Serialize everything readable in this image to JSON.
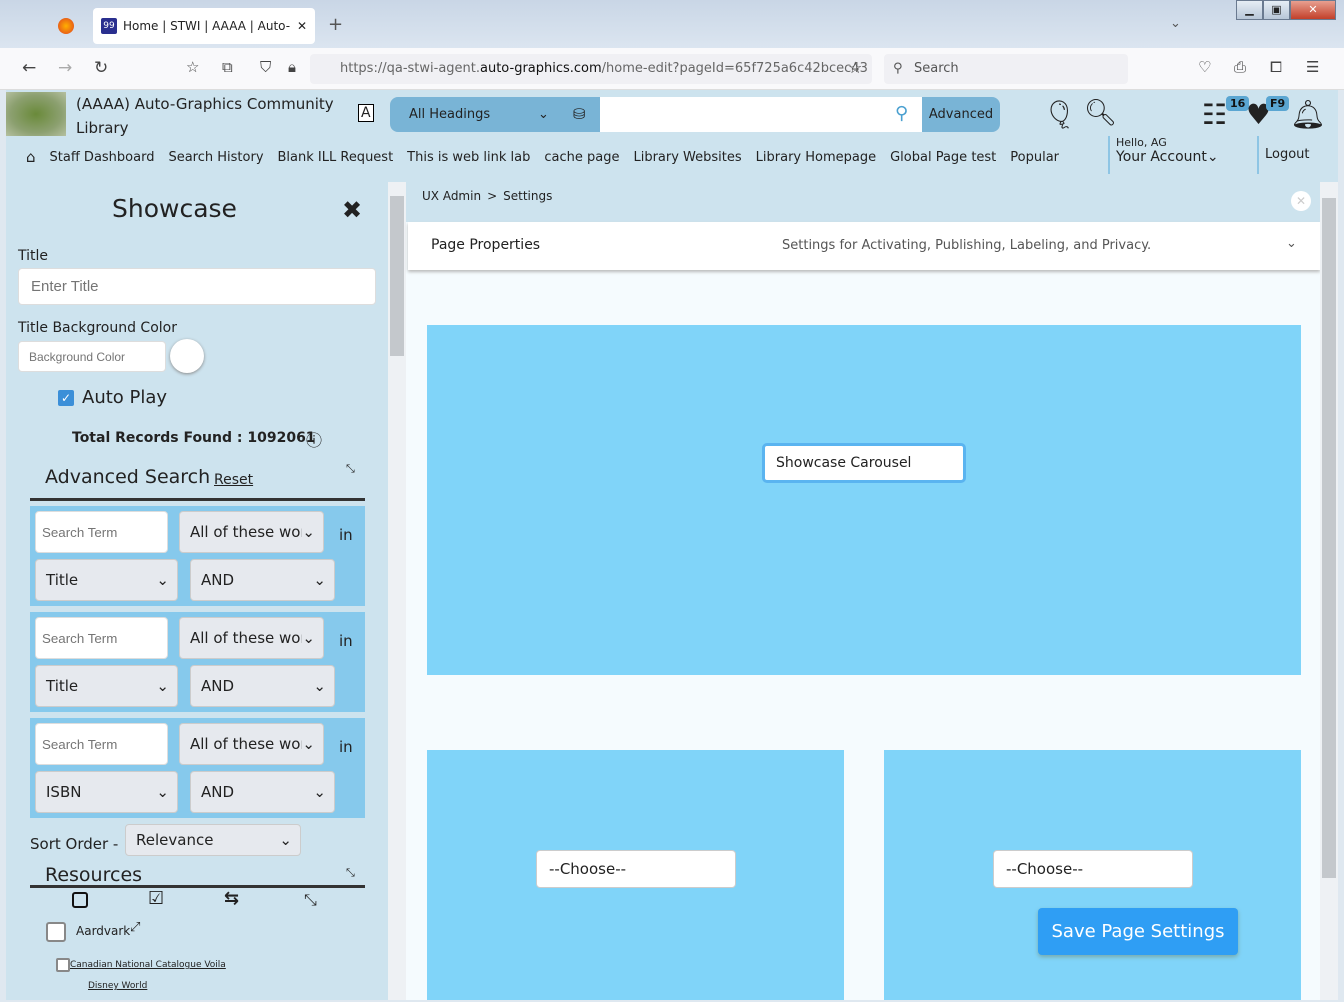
{
  "browser": {
    "tab_title": "Home | STWI | AAAA | Auto-Gra",
    "new_tab": "+",
    "url_prefix": "https://qa-stwi-agent.",
    "url_domain": "auto-graphics.com",
    "url_suffix": "/home-edit?pageId=65f725a6c42bcec43",
    "search_placeholder": "Search"
  },
  "header": {
    "library_name": "(AAAA) Auto-Graphics Community Library",
    "search_scope": "All Headings",
    "search_value": "",
    "advanced": "Advanced",
    "list_badge": "16",
    "fav_badge": "F9"
  },
  "nav": {
    "items": [
      "Staff Dashboard",
      "Search History",
      "Blank ILL Request",
      "This is web link lab",
      "cache page",
      "Library Websites",
      "Library Homepage",
      "Global Page test",
      "Popular"
    ],
    "greeting": "Hello, AG",
    "account": "Your Account",
    "logout": "Logout"
  },
  "panel": {
    "title": "Showcase",
    "title_label": "Title",
    "title_placeholder": "Enter Title",
    "bg_label": "Title Background Color",
    "bg_placeholder": "Background Color",
    "autoplay": "Auto Play",
    "autoplay_checked": true,
    "total": "Total Records Found : 1092061",
    "adv_search": "Advanced Search",
    "reset": "Reset",
    "rows": [
      {
        "term_placeholder": "Search Term",
        "match": "All of these words",
        "in": "in",
        "field": "Title",
        "op": "AND"
      },
      {
        "term_placeholder": "Search Term",
        "match": "All of these words",
        "in": "in",
        "field": "Title",
        "op": "AND"
      },
      {
        "term_placeholder": "Search Term",
        "match": "All of these words",
        "in": "in",
        "field": "ISBN",
        "op": "AND"
      }
    ],
    "sort_label": "Sort Order -",
    "sort_value": "Relevance",
    "resources": "Resources",
    "resource_items": [
      "Aardvark",
      "Canadian National Catalogue Voila",
      "Disney World"
    ]
  },
  "main": {
    "breadcrumb": [
      "UX Admin",
      ">",
      "Settings"
    ],
    "page_props": "Page Properties",
    "page_props_desc": "Settings for Activating, Publishing, Labeling, and Privacy.",
    "carousel": "Showcase Carousel",
    "choose": "--Choose--",
    "save": "Save Page Settings",
    "block_color": "#80d4f9",
    "accent": "#2f9ef4"
  }
}
